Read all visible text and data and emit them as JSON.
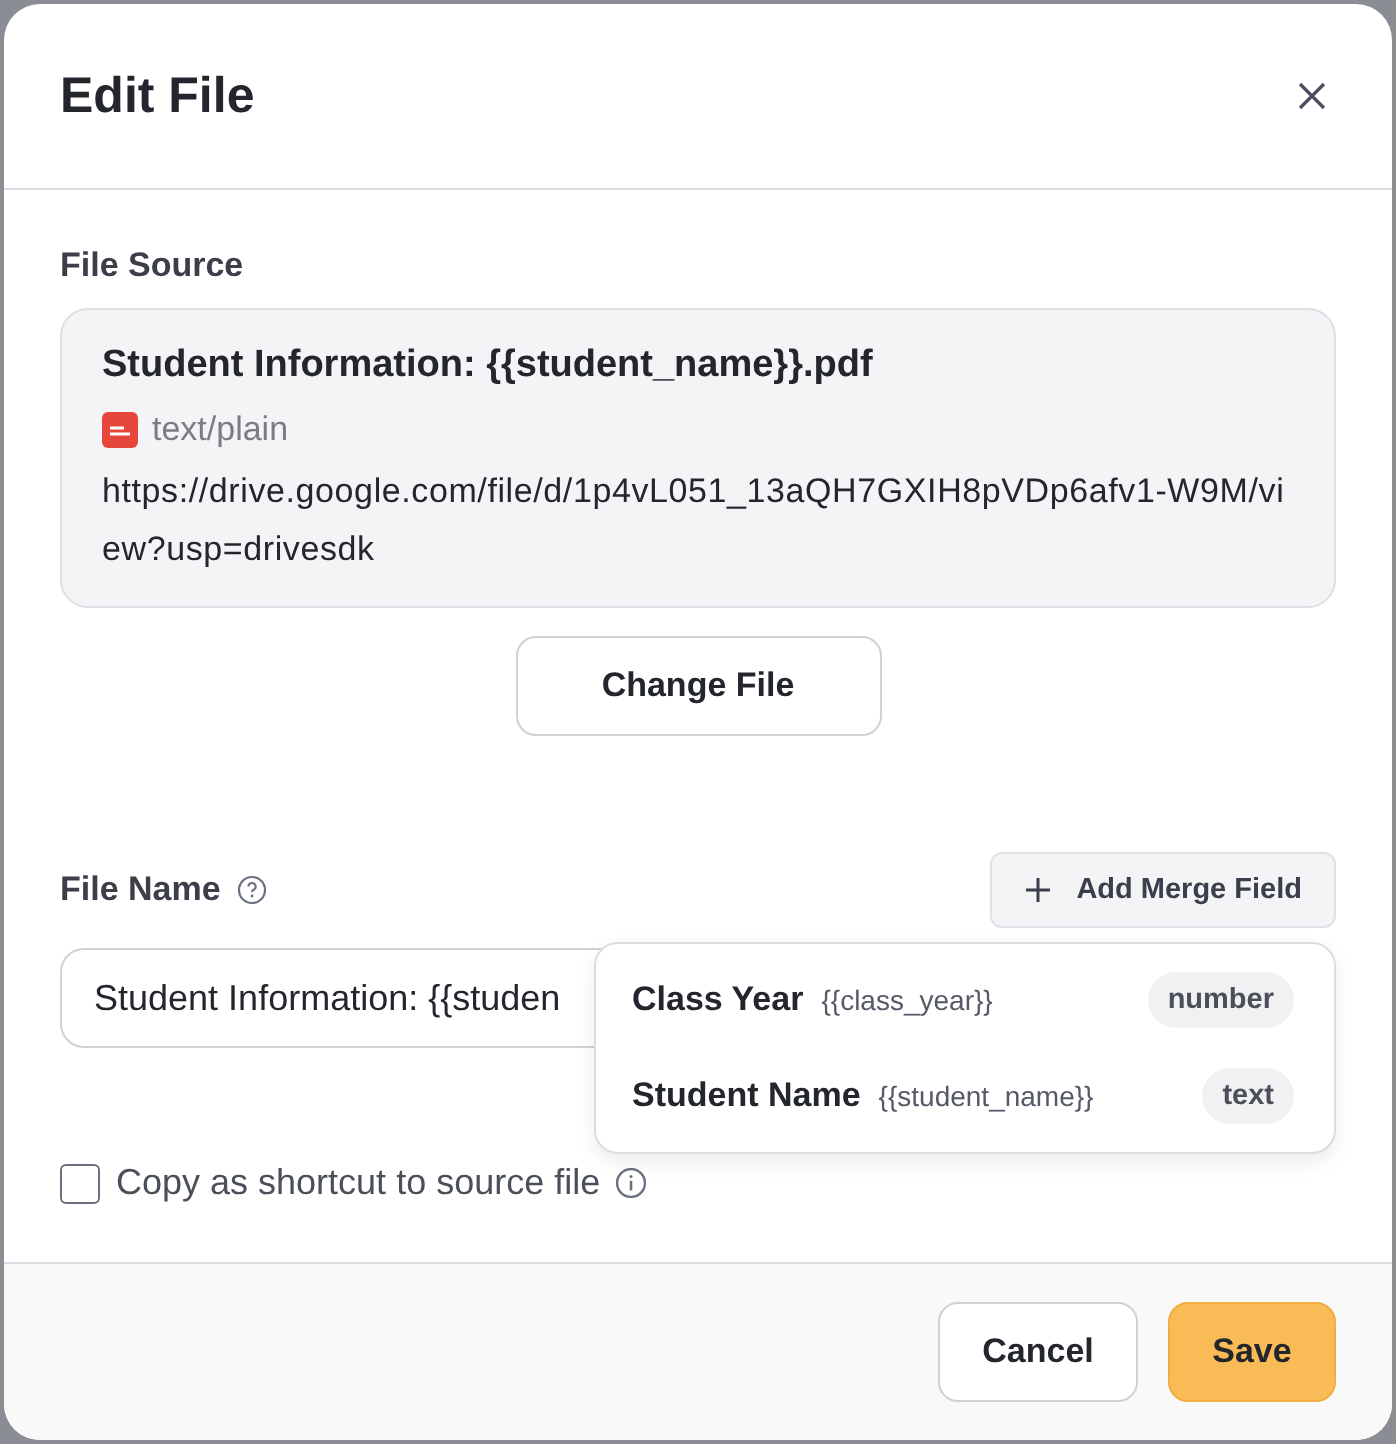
{
  "dialog": {
    "title": "Edit File"
  },
  "file_source": {
    "label": "File Source",
    "file_name": "Student Information: {{student_name}}.pdf",
    "file_type": "text/plain",
    "url": "https://drive.google.com/file/d/1p4vL051_13aQH7GXIH8pVDp6afv1-W9M/view?usp=drivesdk",
    "change_button": "Change File"
  },
  "file_name": {
    "label": "File Name",
    "add_button": "Add Merge Field",
    "value": "Student Information: {{studen"
  },
  "merge_fields": [
    {
      "name": "Class Year",
      "token": "{{class_year}}",
      "type": "number"
    },
    {
      "name": "Student Name",
      "token": "{{student_name}}",
      "type": "text"
    }
  ],
  "shortcut": {
    "label": "Copy as shortcut to source file",
    "checked": false
  },
  "buttons": [
    {
      "label": "Cancel",
      "kind": "secondary"
    },
    {
      "label": "Save",
      "kind": "primary"
    }
  ]
}
